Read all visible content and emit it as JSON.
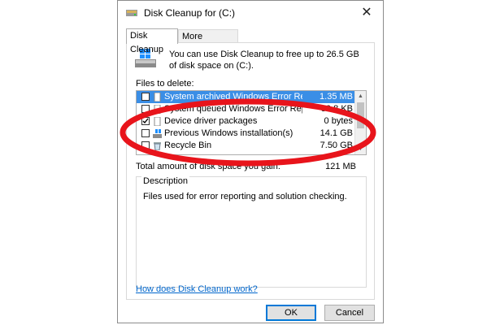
{
  "window": {
    "title": "Disk Cleanup for  (C:)",
    "close_glyph": "✕"
  },
  "tabs": [
    {
      "label": "Disk Cleanup",
      "active": true
    },
    {
      "label": "More Options",
      "active": false
    }
  ],
  "intro_text": "You can use Disk Cleanup to free up to 26.5 GB of disk space on  (C:).",
  "files_label": "Files to delete:",
  "files": [
    {
      "name": "System archived Windows Error Repor...",
      "size": "1.35 MB",
      "checked": false,
      "selected": true,
      "icon": "document-icon"
    },
    {
      "name": "System queued Windows Error Reporti...",
      "size": "39.8 KB",
      "checked": false,
      "selected": false,
      "icon": "document-icon"
    },
    {
      "name": "Device driver packages",
      "size": "0 bytes",
      "checked": true,
      "selected": false,
      "icon": "document-icon"
    },
    {
      "name": "Previous Windows installation(s)",
      "size": "14.1 GB",
      "checked": false,
      "selected": false,
      "icon": "windows-install-icon"
    },
    {
      "name": "Recycle Bin",
      "size": "7.50 GB",
      "checked": false,
      "selected": false,
      "icon": "recycle-bin-icon"
    }
  ],
  "total_label": "Total amount of disk space you gain:",
  "total_value": "121 MB",
  "description": {
    "title": "Description",
    "text": "Files used for error reporting and solution checking."
  },
  "help_link": "How does Disk Cleanup work?",
  "buttons": {
    "ok": "OK",
    "cancel": "Cancel"
  },
  "colors": {
    "selection": "#3a8ee6",
    "annotation_oval": "#e8141b",
    "link": "#0066cc"
  }
}
